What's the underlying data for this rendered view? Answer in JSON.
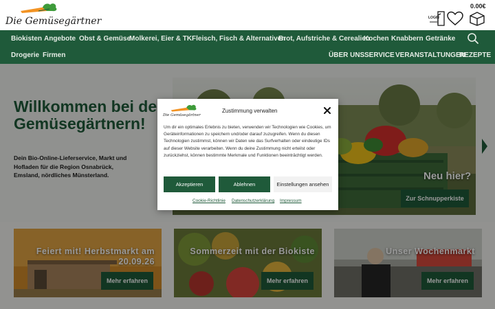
{
  "header": {
    "logo_text": "Die Gemüsegärtner",
    "cart_amount": "0.00€",
    "login_label": "LOGIN",
    "login_icon": "login-door-icon",
    "wishlist_icon": "heart-icon",
    "cart_icon": "cart-box-icon"
  },
  "nav": {
    "row1": [
      "Biokisten",
      "Angebote",
      "Obst & Gemüse",
      "Molkerei, Eier & TK",
      "Fleisch, Fisch & Alternativen",
      "Brot, Aufstriche & Cerealien",
      "Kochen",
      "Knabbern",
      "Getränke"
    ],
    "row2_left": [
      "Drogerie",
      "Firmen"
    ],
    "row2_right": [
      "ÜBER UNS",
      "SERVICE",
      "VERANSTALTUNGEN",
      "REZEPTE"
    ],
    "search_icon": "search-icon"
  },
  "hero": {
    "title": "Willkommen bei den Gemüsegärtnern!",
    "subtitle": "Dein Bio-Online-Lieferservice, Markt und Hofladen für die Region Osnabrück, Emsland, nördliches Münsterland.",
    "slide_title": "Neu hier?",
    "slide_button": "Zur Schnupperkiste",
    "next_icon": "chevron-right-icon"
  },
  "cards": [
    {
      "title": "Feiert mit! Herbstmarkt am 20.09.26",
      "button": "Mehr erfahren"
    },
    {
      "title": "Sommerzeit mit der Biokiste",
      "button": "Mehr erfahren"
    },
    {
      "title": "Unser Wochenmarkt",
      "button": "Mehr erfahren"
    }
  ],
  "consent": {
    "logo_text": "Die Gemüsegärtner",
    "title": "Zustimmung verwalten",
    "text": "Um dir ein optimales Erlebnis zu bieten, verwenden wir Technologien wie Cookies, um Geräteinformationen zu speichern und/oder darauf zuzugreifen. Wenn du diesen Technologien zustimmst, können wir Daten wie das Surfverhalten oder eindeutige IDs auf dieser Website verarbeiten. Wenn du deine Zustimmung nicht erteilst oder zurückziehst, können bestimmte Merkmale und Funktionen beeinträchtigt werden.",
    "accept": "Akzeptieren",
    "deny": "Ablehnen",
    "settings": "Einstellungen ansehen",
    "links": [
      "Cookie-Richtlinie",
      "Datenschutzerklärung",
      "Impressum"
    ],
    "close_icon": "close-icon"
  },
  "colors": {
    "brand_green": "#1f5a3a",
    "overlay": "rgba(0,0,0,0.40)"
  }
}
